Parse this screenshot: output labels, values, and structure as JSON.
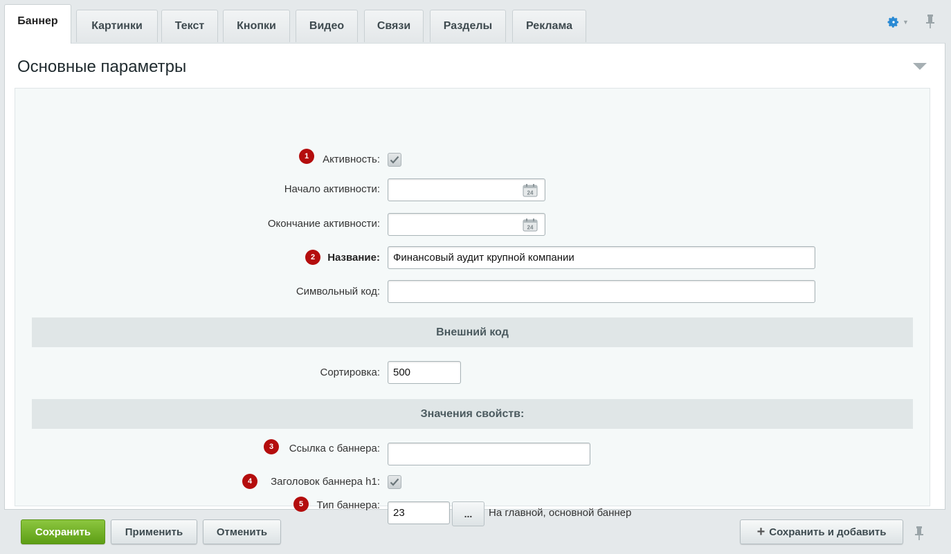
{
  "tabs": [
    {
      "label": "Баннер",
      "active": true
    },
    {
      "label": "Картинки"
    },
    {
      "label": "Текст"
    },
    {
      "label": "Кнопки"
    },
    {
      "label": "Видео"
    },
    {
      "label": "Связи"
    },
    {
      "label": "Разделы"
    },
    {
      "label": "Реклама"
    }
  ],
  "toolbar": {
    "settings_icon": "gear-icon",
    "pin_icon": "pin-icon",
    "accent": "#2a8ad4"
  },
  "section": {
    "title": "Основные параметры"
  },
  "form": {
    "active": {
      "num": "1",
      "label": "Активность:",
      "checked": true
    },
    "start": {
      "label": "Начало активности:",
      "value": "",
      "cal_day": "24"
    },
    "end": {
      "label": "Окончание активности:",
      "value": "",
      "cal_day": "24"
    },
    "name": {
      "num": "2",
      "label": "Название:",
      "value": "Финансовый аудит крупной компании"
    },
    "code": {
      "label": "Символьный код:",
      "value": ""
    },
    "external_head": "Внешний код",
    "sort": {
      "label": "Сортировка:",
      "value": "500"
    },
    "props_head": "Значения свойств:",
    "link": {
      "num": "3",
      "label": "Ссылка с баннера:",
      "value": ""
    },
    "h1": {
      "num": "4",
      "label": "Заголовок баннера h1:",
      "checked": true
    },
    "type": {
      "num": "5",
      "label": "Тип баннера:",
      "value": "23",
      "button": "...",
      "after": "На главной, основной баннер"
    }
  },
  "footer": {
    "save": "Сохранить",
    "apply": "Применить",
    "cancel": "Отменить",
    "save_add": "Сохранить и добавить",
    "save_color": "#6aaf1f"
  }
}
